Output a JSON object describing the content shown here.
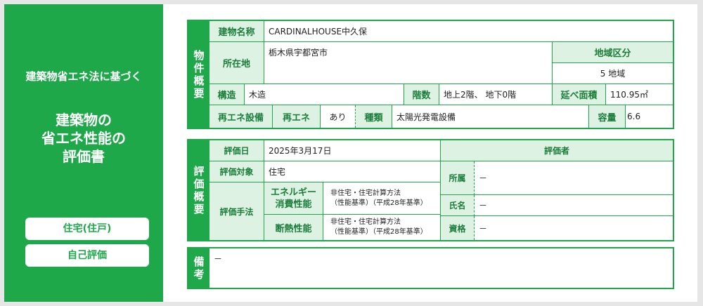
{
  "left": {
    "law": "建築物省エネ法に基づく",
    "title_lines": [
      "建築物の",
      "省エネ性能の",
      "評価書"
    ],
    "pill1": "住宅(住戸)",
    "pill2": "自己評価"
  },
  "colors": {
    "accent": "#1ea84a",
    "label_bg": "#def2e3"
  },
  "overview": {
    "header": [
      "物",
      "件",
      "概",
      "要"
    ],
    "building_name_label": "建物名称",
    "building_name": "CARDINALHOUSE中久保",
    "address_label": "所在地",
    "address": "栃木県宇都宮市",
    "region_label": "地域区分",
    "region": "5 地域",
    "structure_label": "構造",
    "structure": "木造",
    "floors_label": "階数",
    "floors": "地上2階、 地下0階",
    "floor_area_label": "延べ面積",
    "floor_area": "110.95㎡",
    "renew_label": "再エネ設備",
    "renew_sub_label": "再エネ",
    "renew": "あり",
    "kind_label": "種類",
    "kind": "太陽光発電設備",
    "capacity_label": "容量",
    "capacity": "6.6"
  },
  "evaluation": {
    "header": [
      "評",
      "価",
      "概",
      "要"
    ],
    "date_label": "評価日",
    "date": "2025年3月17日",
    "target_label": "評価対象",
    "target": "住宅",
    "method_label": "評価手法",
    "energy_label_1": "エネルギー",
    "energy_label_2": "消費性能",
    "energy_method_1": "非住宅・住宅計算方法",
    "energy_method_2": "（性能基準）（平成28年基準）",
    "insulation_label": "断熱性能",
    "insulation_method_1": "非住宅・住宅計算方法",
    "insulation_method_2": "（性能基準）（平成28年基準）",
    "evaluator_label": "評価者",
    "affiliation_label": "所属",
    "affiliation": "－",
    "name_label": "氏名",
    "name": "－",
    "qualification_label": "資格",
    "qualification": "－"
  },
  "remarks": {
    "header": [
      "備",
      "考"
    ],
    "text": "－"
  }
}
